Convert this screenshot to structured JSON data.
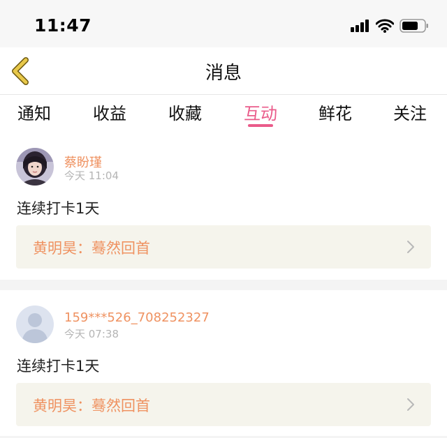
{
  "status_bar": {
    "time": "11:47"
  },
  "nav": {
    "title": "消息"
  },
  "tabs": [
    {
      "label": "通知"
    },
    {
      "label": "收益"
    },
    {
      "label": "收藏"
    },
    {
      "label": "互动",
      "active": true
    },
    {
      "label": "鲜花"
    },
    {
      "label": "关注"
    }
  ],
  "messages": [
    {
      "user": "蔡盼瑾",
      "time": "今天 11:04",
      "text": "连续打卡1天",
      "quote": "黄明昊：蓦然回首",
      "avatar": "photo-avatar"
    },
    {
      "user": "159***526_708252327",
      "time": "今天 07:38",
      "text": "连续打卡1天",
      "quote": "黄明昊：蓦然回首",
      "avatar": "default-avatar"
    }
  ],
  "colors": {
    "accent_pink": "#ea5b8a",
    "username_orange": "#ef9261",
    "quote_bg": "#f5f4ec",
    "back_arrow": "#e8c84a"
  }
}
